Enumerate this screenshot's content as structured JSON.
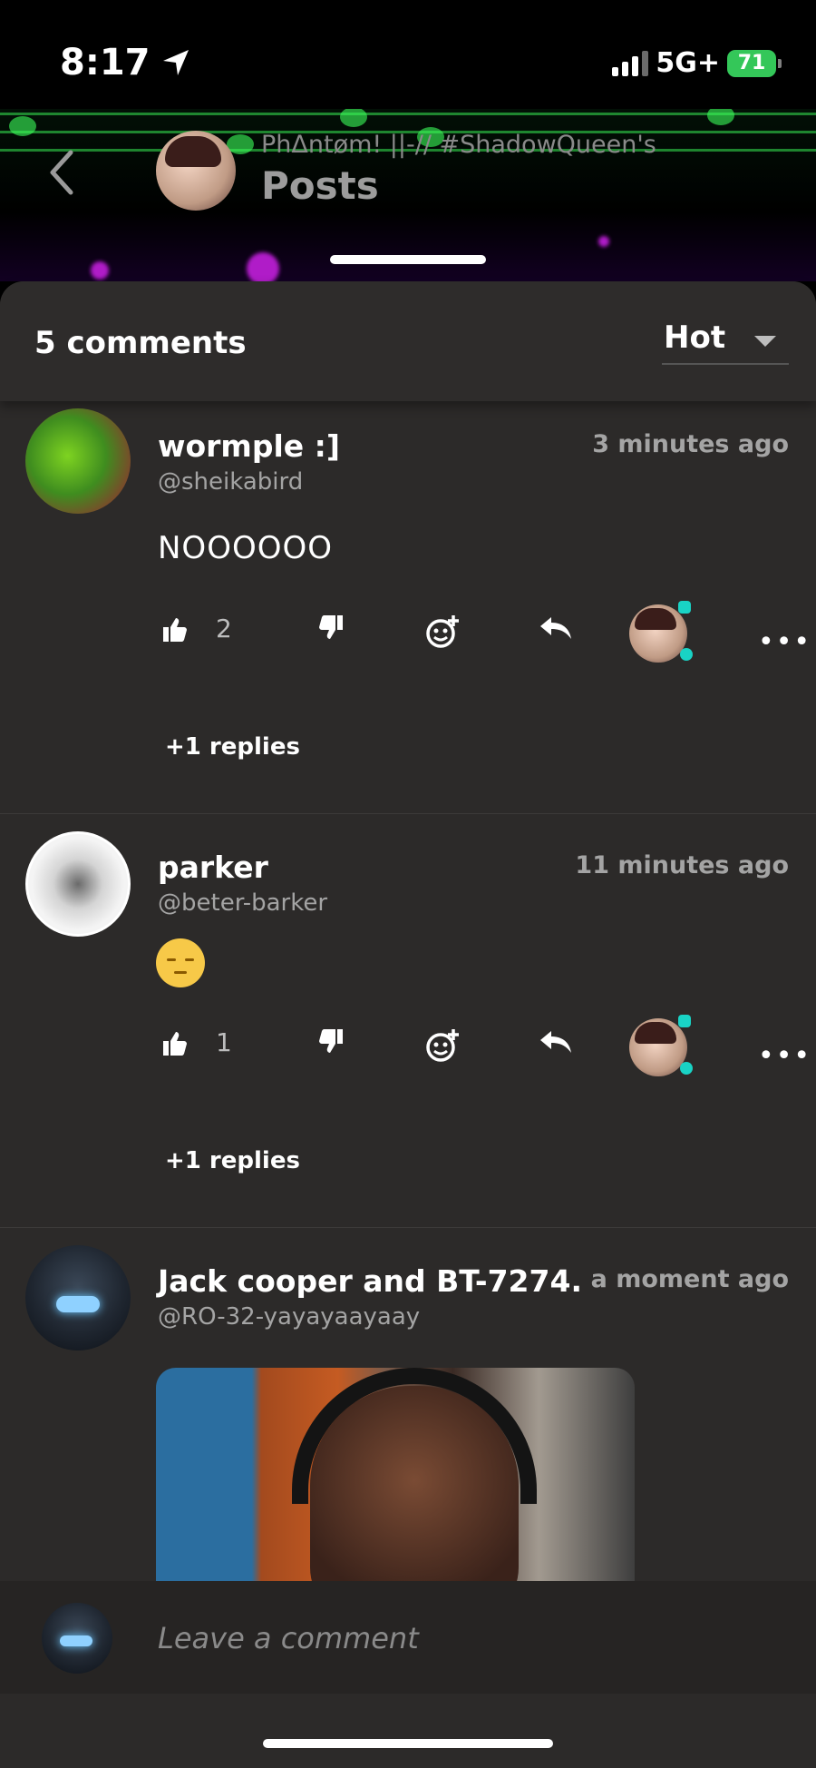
{
  "status": {
    "time": "8:17",
    "network": "5G+",
    "battery": "71"
  },
  "header": {
    "subtitle": "PhΔntøm! ||-// #ShadowQueen's",
    "title": "Posts"
  },
  "comments_header": {
    "count_label": "5 comments",
    "sort_label": "Hot"
  },
  "comments": [
    {
      "name": "wormple :]",
      "handle": "@sheikabird",
      "time": "3 minutes ago",
      "text": "NOOOOOO",
      "likes": "2",
      "replies": "+1 replies"
    },
    {
      "name": "parker",
      "handle": "@beter-barker",
      "time": "11 minutes ago",
      "text": "",
      "likes": "1",
      "replies": "+1 replies"
    },
    {
      "name": "Jack cooper and BT-7274.",
      "handle": "@RO-32-yayayaayaay",
      "time": "a moment ago"
    }
  ],
  "composer": {
    "placeholder": "Leave a comment"
  },
  "colors": {
    "background": "#2c2a29",
    "accent": "#19d3c5",
    "battery": "#34c759"
  }
}
